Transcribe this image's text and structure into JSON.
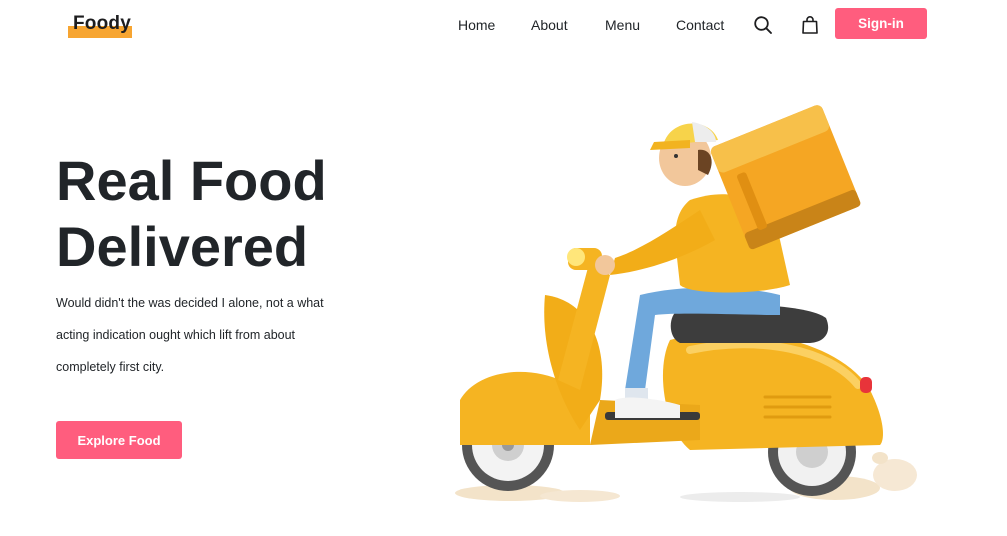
{
  "brand": {
    "name": "Foody",
    "accent": "#f7a531"
  },
  "nav": {
    "links": [
      "Home",
      "About",
      "Menu",
      "Contact"
    ],
    "search_icon": "search-icon",
    "bag_icon": "shopping-bag-icon",
    "signin_label": "Sign-in",
    "signin_color": "#ff5d7e"
  },
  "hero": {
    "title_line1": "Real Food",
    "title_line2": "Delivered",
    "description": "Would didn't the was decided I alone, not a what acting indication ought which lift from about completely first city.",
    "cta_label": "Explore Food",
    "image": "delivery-scooter-illustration"
  }
}
